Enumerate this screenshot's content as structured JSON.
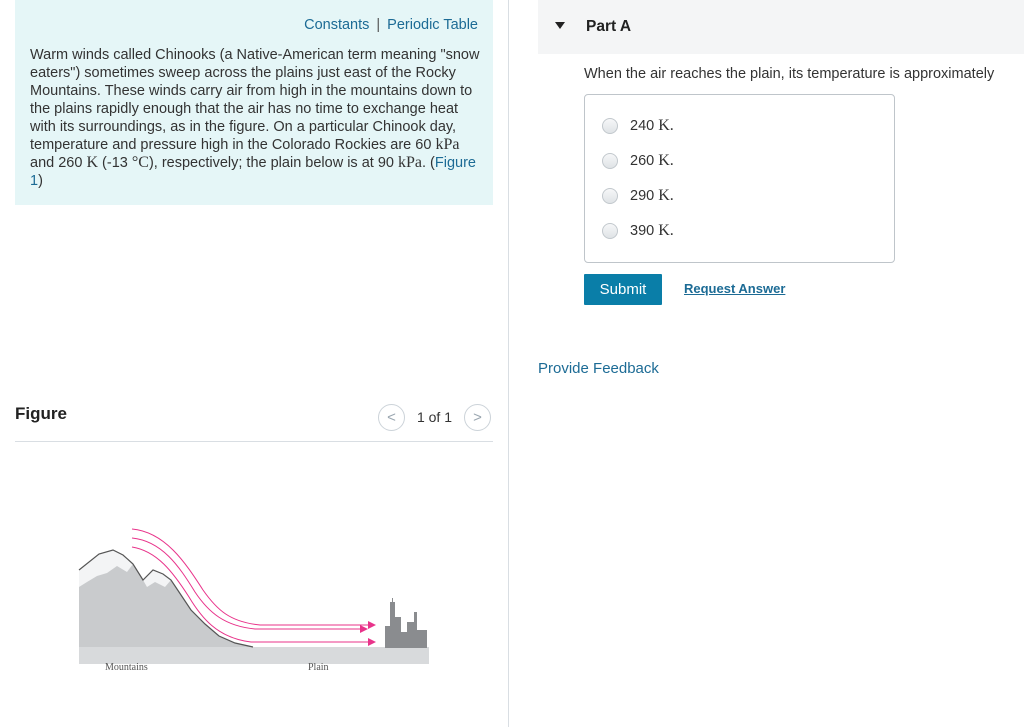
{
  "problem": {
    "links": {
      "constants": "Constants",
      "separator": "|",
      "periodic_table": "Periodic Table"
    },
    "text": {
      "p1": "Warm winds called Chinooks (a Native-American term meaning \"snow eaters\") sometimes sweep across the plains just east of the Rocky Mountains. These winds carry air from high in the mountains down to the plains rapidly enough that the air has no time to exchange heat with its surroundings, as in the figure. On a particular Chinook day, temperature and pressure high in the Colorado Rockies are 60 ",
      "unit_kpa": "kPa",
      "p2": " and 260 ",
      "unit_k": "K",
      "p3": " (-13 ",
      "unit_degc": "°C",
      "p4": "), respectively; the plain below is at 90 ",
      "unit_kpa2": "kPa",
      "p5": ". (",
      "figure_link": "Figure 1",
      "p6": ")"
    }
  },
  "figure": {
    "title": "Figure",
    "pager": {
      "prev": "<",
      "label": "1 of 1",
      "next": ">"
    },
    "captions": {
      "mountains": "Mountains",
      "plain": "Plain"
    },
    "colors": {
      "mountain": "#c9cbcd",
      "snow": "#f3f4f5",
      "ground": "#d8dadc",
      "arrow": "#e8338a",
      "town": "#8a8c8f"
    }
  },
  "part": {
    "title": "Part A",
    "question": "When the air reaches the plain, its temperature is approximately",
    "options": [
      {
        "value": "240 ",
        "unit": "K."
      },
      {
        "value": "260 ",
        "unit": "K."
      },
      {
        "value": "290 ",
        "unit": "K."
      },
      {
        "value": "390 ",
        "unit": "K."
      }
    ],
    "submit": "Submit",
    "request_answer": "Request Answer"
  },
  "feedback": "Provide Feedback"
}
